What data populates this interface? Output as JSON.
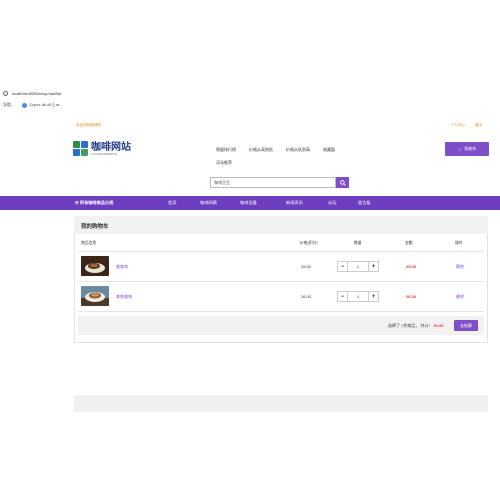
{
  "browser": {
    "url": "localhost:8080/shop/cart/list",
    "bookmarks": [
      {
        "label": "导航..."
      },
      {
        "label": "Zoyoz-dk-d5上ar..."
      }
    ]
  },
  "topline": {
    "welcome": "欢迎光临咖啡网",
    "links": [
      "个人中心",
      "退出"
    ]
  },
  "logo": {
    "name_cn": "咖啡网站",
    "name_en": "COFFEEWEBSITE"
  },
  "nav_links": [
    "销量排行榜",
    "价格从高到低",
    "价格从低到高",
    "收藏量",
    "浮动推荐"
  ],
  "cart_button": "购物车",
  "search": {
    "placeholder": "咖啡豆豆",
    "button_icon": "search-icon"
  },
  "menubar": {
    "category": "所有咖啡商品分类",
    "items": [
      "首页",
      "咖啡网摘",
      "咖啡设备",
      "新闻资讯",
      "论坛",
      "留言板"
    ]
  },
  "cart": {
    "title": "我的购物车",
    "headers": {
      "info": "商品信息",
      "price": "价格(积分)",
      "qty": "数量",
      "amount": "金额",
      "op": "操作"
    },
    "items": [
      {
        "name": "美咖啡",
        "price": "25.00",
        "qty": "1",
        "amount": "25.00",
        "op": "删除"
      },
      {
        "name": "拿铁咖啡",
        "price": "26.00",
        "qty": "1",
        "amount": "26.00",
        "op": "删除"
      }
    ],
    "summary_prefix": "选择了",
    "summary_count": "2",
    "summary_mid": "件商品，  共计：",
    "summary_total": "51.00",
    "checkout": "去结算"
  },
  "colors": {
    "accent": "#7f4fc9",
    "menubar": "#6d3fc0",
    "price_red": "#e03030",
    "welcome": "#e08a2a"
  }
}
